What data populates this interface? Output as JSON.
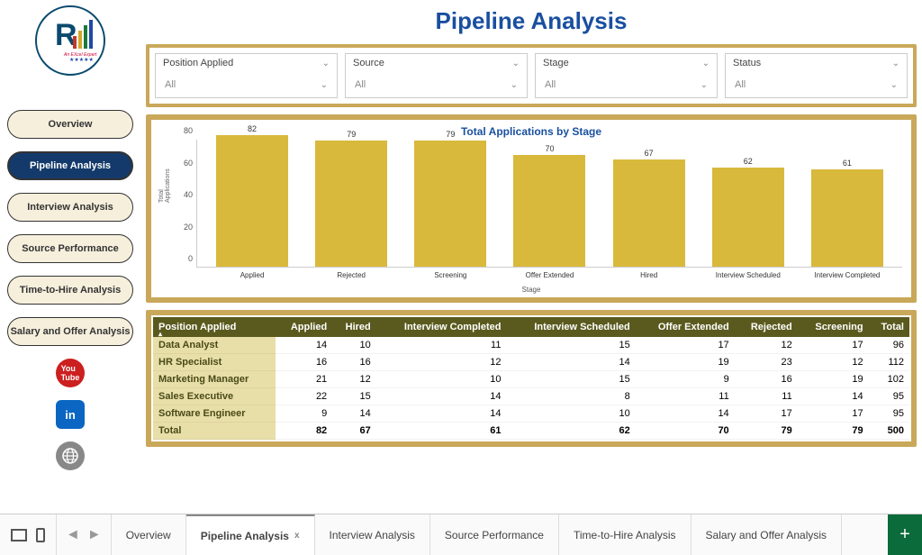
{
  "page_title": "Pipeline Analysis",
  "nav": [
    {
      "label": "Overview",
      "active": false
    },
    {
      "label": "Pipeline Analysis",
      "active": true
    },
    {
      "label": "Interview Analysis",
      "active": false
    },
    {
      "label": "Source Performance",
      "active": false
    },
    {
      "label": "Time-to-Hire Analysis",
      "active": false
    },
    {
      "label": "Salary and Offer Analysis",
      "active": false
    }
  ],
  "filters": [
    {
      "label": "Position Applied",
      "value": "All"
    },
    {
      "label": "Source",
      "value": "All"
    },
    {
      "label": "Stage",
      "value": "All"
    },
    {
      "label": "Status",
      "value": "All"
    }
  ],
  "bottom_tabs": {
    "items": [
      "Overview",
      "Pipeline Analysis",
      "Interview Analysis",
      "Source Performance",
      "Time-to-Hire Analysis",
      "Salary and Offer Analysis"
    ],
    "active": "Pipeline Analysis"
  },
  "chart_data": {
    "type": "bar",
    "title": "Total Applications by Stage",
    "xlabel": "Stage",
    "ylabel": "Total Applications",
    "ylim": [
      0,
      80
    ],
    "yticks": [
      0,
      20,
      40,
      60,
      80
    ],
    "categories": [
      "Applied",
      "Rejected",
      "Screening",
      "Offer Extended",
      "Hired",
      "Interview Scheduled",
      "Interview Completed"
    ],
    "values": [
      82,
      79,
      79,
      70,
      67,
      62,
      61
    ],
    "bar_color": "#d9b93c"
  },
  "table": {
    "columns": [
      "Position Applied",
      "Applied",
      "Hired",
      "Interview Completed",
      "Interview Scheduled",
      "Offer Extended",
      "Rejected",
      "Screening",
      "Total"
    ],
    "rows": [
      [
        "Data Analyst",
        14,
        10,
        11,
        15,
        17,
        12,
        17,
        96
      ],
      [
        "HR Specialist",
        16,
        16,
        12,
        14,
        19,
        23,
        12,
        112
      ],
      [
        "Marketing Manager",
        21,
        12,
        10,
        15,
        9,
        16,
        19,
        102
      ],
      [
        "Sales Executive",
        22,
        15,
        14,
        8,
        11,
        11,
        14,
        95
      ],
      [
        "Software Engineer",
        9,
        14,
        14,
        10,
        14,
        17,
        17,
        95
      ]
    ],
    "total_row": [
      "Total",
      82,
      67,
      61,
      62,
      70,
      79,
      79,
      500
    ]
  }
}
